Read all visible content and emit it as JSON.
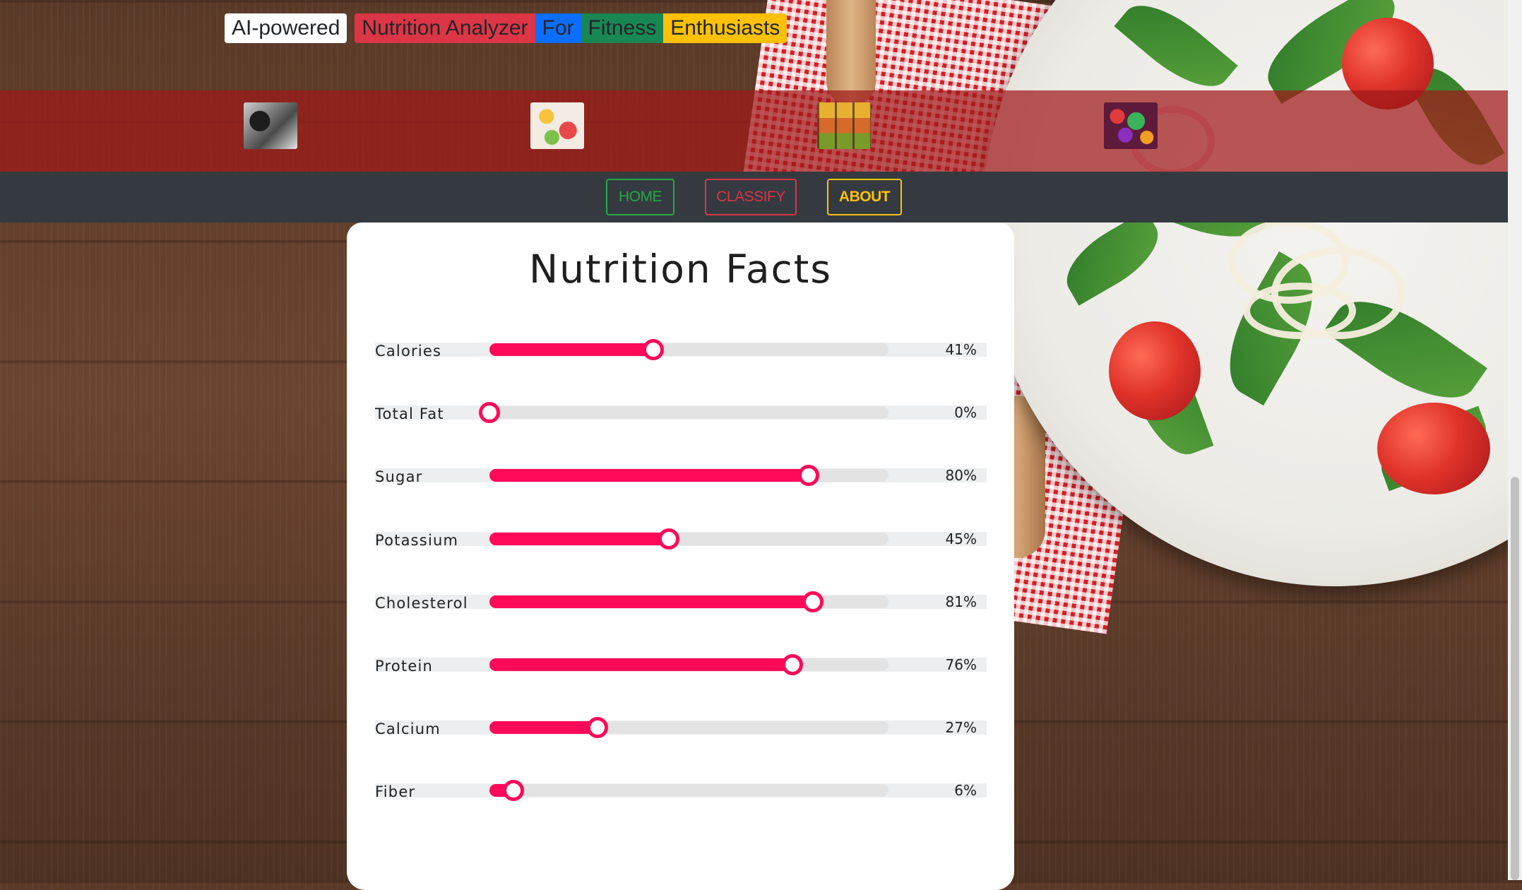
{
  "header": {
    "title_words": [
      "AI-powered",
      "Nutrition Analyzer",
      "For",
      "Fitness",
      "Enthusiasts"
    ],
    "title_colors": [
      "#ffffff",
      "#dc3545",
      "#0d6efd",
      "#198754",
      "#ffc107"
    ]
  },
  "image_strip": {
    "thumbnails": [
      "phone-food-photo",
      "fruit-platter",
      "fruit-crates",
      "mixed-fruits"
    ]
  },
  "nav": {
    "home_label": "HOME",
    "classify_label": "CLASSIFY",
    "about_label": "ABOUT",
    "colors": {
      "home": "#28a745",
      "classify": "#dc3545",
      "about": "#ffc107"
    }
  },
  "nutrition": {
    "title": "Nutrition Facts",
    "accent_color": "#ff0a5a",
    "items": [
      {
        "label": "Calories",
        "value": 41,
        "display": "41%"
      },
      {
        "label": "Total Fat",
        "value": 0,
        "display": "0%"
      },
      {
        "label": "Sugar",
        "value": 80,
        "display": "80%"
      },
      {
        "label": "Potassium",
        "value": 45,
        "display": "45%"
      },
      {
        "label": "Cholesterol",
        "value": 81,
        "display": "81%"
      },
      {
        "label": "Protein",
        "value": 76,
        "display": "76%"
      },
      {
        "label": "Calcium",
        "value": 27,
        "display": "27%"
      },
      {
        "label": "Fiber",
        "value": 6,
        "display": "6%"
      }
    ]
  }
}
